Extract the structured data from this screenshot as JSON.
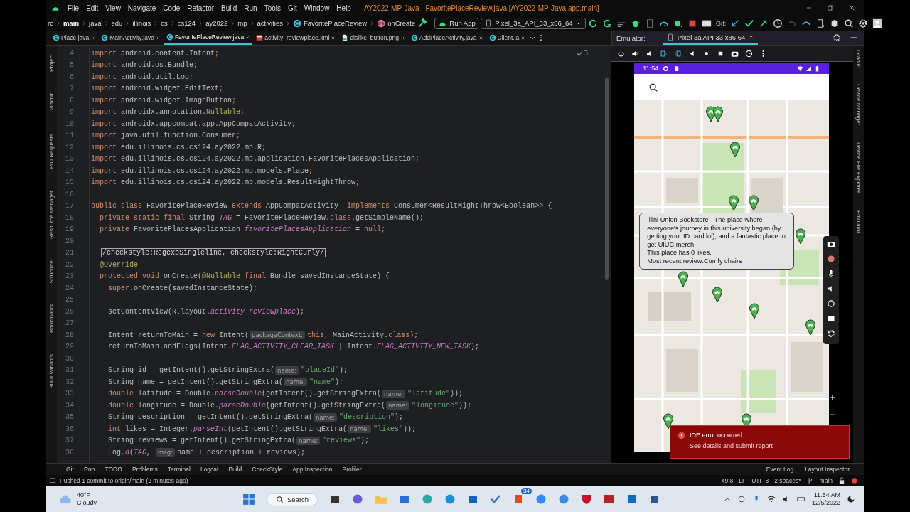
{
  "menu_bar": {
    "items": [
      "File",
      "Edit",
      "View",
      "Navigate",
      "Code",
      "Refactor",
      "Build",
      "Run",
      "Tools",
      "Git",
      "Window",
      "Help"
    ],
    "title": "AY2022-MP-Java - FavoritePlaceReview.java [AY2022-MP-Java.app.main]"
  },
  "breadcrumb": [
    {
      "label": "rc",
      "emphasis": false,
      "kind": "folder"
    },
    {
      "label": "main",
      "emphasis": true,
      "kind": "folder"
    },
    {
      "label": "java",
      "emphasis": false,
      "kind": "folder"
    },
    {
      "label": "edu",
      "emphasis": false,
      "kind": "folder"
    },
    {
      "label": "illinois",
      "emphasis": false,
      "kind": "folder"
    },
    {
      "label": "cs",
      "emphasis": false,
      "kind": "folder"
    },
    {
      "label": "cs124",
      "emphasis": false,
      "kind": "folder"
    },
    {
      "label": "ay2022",
      "emphasis": false,
      "kind": "folder"
    },
    {
      "label": "mp",
      "emphasis": false,
      "kind": "folder"
    },
    {
      "label": "activities",
      "emphasis": false,
      "kind": "folder"
    },
    {
      "label": "FavoritePlaceReview",
      "emphasis": false,
      "kind": "class"
    },
    {
      "label": "onCreate",
      "emphasis": false,
      "kind": "method"
    }
  ],
  "run_config": "Run App",
  "device": "Pixel_3a_API_33_x86_64",
  "git_label": "Git:",
  "tabs": [
    {
      "label": "Place.java",
      "kind": "java",
      "selected": false
    },
    {
      "label": "MainActivity.java",
      "kind": "java",
      "selected": false
    },
    {
      "label": "FavoritePlaceReview.java",
      "kind": "java",
      "selected": true
    },
    {
      "label": "activity_reviewplace.xml",
      "kind": "xml",
      "selected": false
    },
    {
      "label": "dislike_button.png",
      "kind": "png",
      "selected": false
    },
    {
      "label": "AddPlaceActivity.java",
      "kind": "java",
      "selected": false
    },
    {
      "label": "Client.ja",
      "kind": "java",
      "selected": false
    }
  ],
  "left_tools": [
    "Project",
    "Commit",
    "Pull Requests",
    "Resource Manager",
    "Structure",
    "Bookmarks",
    "Build Variants"
  ],
  "right_tools": [
    "Gradle",
    "Device Manager",
    "Device File Explorer",
    "Emulator"
  ],
  "editor": {
    "inspection_count": "3",
    "lines": [
      {
        "number": "4",
        "segments": [
          {
            "kind": "kw",
            "text": "import "
          },
          {
            "kind": "plain",
            "text": "android.content.Intent"
          },
          {
            "kind": "kw",
            "text": ";"
          }
        ]
      },
      {
        "number": "5",
        "segments": [
          {
            "kind": "kw",
            "text": "import "
          },
          {
            "kind": "plain",
            "text": "android.os.Bundle"
          },
          {
            "kind": "kw",
            "text": ";"
          }
        ]
      },
      {
        "number": "6",
        "segments": [
          {
            "kind": "kw",
            "text": "import "
          },
          {
            "kind": "plain",
            "text": "android.util.Log"
          },
          {
            "kind": "kw",
            "text": ";"
          }
        ]
      },
      {
        "number": "7",
        "segments": [
          {
            "kind": "kw",
            "text": "import "
          },
          {
            "kind": "plain",
            "text": "android.widget.EditText"
          },
          {
            "kind": "kw",
            "text": ";"
          }
        ]
      },
      {
        "number": "8",
        "segments": [
          {
            "kind": "kw",
            "text": "import "
          },
          {
            "kind": "plain",
            "text": "android.widget.ImageButton"
          },
          {
            "kind": "kw",
            "text": ";"
          }
        ]
      },
      {
        "number": "9",
        "segments": [
          {
            "kind": "kw",
            "text": "import "
          },
          {
            "kind": "plain",
            "text": "androidx.annotation."
          },
          {
            "kind": "ann",
            "text": "Nullable"
          },
          {
            "kind": "kw",
            "text": ";"
          }
        ]
      },
      {
        "number": "10",
        "segments": [
          {
            "kind": "kw",
            "text": "import "
          },
          {
            "kind": "plain",
            "text": "androidx.appcompat.app.AppCompatActivity"
          },
          {
            "kind": "kw",
            "text": ";"
          }
        ]
      },
      {
        "number": "11",
        "segments": [
          {
            "kind": "kw",
            "text": "import "
          },
          {
            "kind": "plain",
            "text": "java.util.function.Consumer"
          },
          {
            "kind": "kw",
            "text": ";"
          }
        ]
      },
      {
        "number": "12",
        "segments": [
          {
            "kind": "kw",
            "text": "import "
          },
          {
            "kind": "plain",
            "text": "edu.illinois.cs.cs124.ay2022.mp.R"
          },
          {
            "kind": "kw",
            "text": ";"
          }
        ]
      },
      {
        "number": "13",
        "segments": [
          {
            "kind": "kw",
            "text": "import "
          },
          {
            "kind": "plain",
            "text": "edu.illinois.cs.cs124.ay2022.mp.application.FavoritePlacesApplication"
          },
          {
            "kind": "kw",
            "text": ";"
          }
        ]
      },
      {
        "number": "14",
        "segments": [
          {
            "kind": "kw",
            "text": "import "
          },
          {
            "kind": "plain",
            "text": "edu.illinois.cs.cs124.ay2022.mp.models.Place"
          },
          {
            "kind": "kw",
            "text": ";"
          }
        ]
      },
      {
        "number": "15",
        "segments": [
          {
            "kind": "kw",
            "text": "import "
          },
          {
            "kind": "plain",
            "text": "edu.illinois.cs.cs124.ay2022.mp.models.ResultMightThrow"
          },
          {
            "kind": "kw",
            "text": ";"
          }
        ]
      },
      {
        "number": "16"
      },
      {
        "number": "17",
        "segments": [
          {
            "kind": "kw",
            "text": "public class "
          },
          {
            "kind": "plain",
            "text": "FavoritePlaceReview "
          },
          {
            "kind": "kw",
            "text": "extends "
          },
          {
            "kind": "plain",
            "text": "AppCompatActivity  "
          },
          {
            "kind": "kw",
            "text": "implements "
          },
          {
            "kind": "plain",
            "text": "Consumer<ResultMightThrow<Boolean>> {"
          }
        ]
      },
      {
        "number": "18",
        "segments": [
          {
            "kind": "kw",
            "text": "  private static final "
          },
          {
            "kind": "plain",
            "text": "String "
          },
          {
            "kind": "field",
            "text": "TAG"
          },
          {
            "kind": "plain",
            "text": " = FavoritePlaceReview."
          },
          {
            "kind": "kw",
            "text": "class"
          },
          {
            "kind": "plain",
            "text": ".getSimpleName();"
          }
        ]
      },
      {
        "number": "19",
        "segments": [
          {
            "kind": "kw",
            "text": "  private "
          },
          {
            "kind": "plain",
            "text": "FavoritePlacesApplication "
          },
          {
            "kind": "field",
            "text": "favoritePlacesApplication"
          },
          {
            "kind": "plain",
            "text": " = "
          },
          {
            "kind": "kw",
            "text": "null;"
          }
        ]
      },
      {
        "number": "20"
      },
      {
        "number": "21",
        "segments": [
          {
            "kind": "boxed",
            "text": "/checkstyle:RegexpSingleline, checkstyle:RightCurly/"
          }
        ]
      },
      {
        "number": "22",
        "segments": [
          {
            "kind": "ann",
            "text": "  @Override"
          }
        ]
      },
      {
        "number": "23",
        "segments": [
          {
            "kind": "kw",
            "text": "  protected void "
          },
          {
            "kind": "plain",
            "text": "onCreate("
          },
          {
            "kind": "ann",
            "text": "@Nullable "
          },
          {
            "kind": "kw",
            "text": "final "
          },
          {
            "kind": "plain",
            "text": "Bundle savedInstanceState) {"
          }
        ]
      },
      {
        "number": "24",
        "segments": [
          {
            "kind": "kw",
            "text": "    super"
          },
          {
            "kind": "plain",
            "text": ".onCreate(savedInstanceState);"
          }
        ]
      },
      {
        "number": "25"
      },
      {
        "number": "26",
        "segments": [
          {
            "kind": "plain",
            "text": "    setContentView(R.layout."
          },
          {
            "kind": "field",
            "text": "activity_reviewplace"
          },
          {
            "kind": "plain",
            "text": ");"
          }
        ]
      },
      {
        "number": "27"
      },
      {
        "number": "28",
        "segments": [
          {
            "kind": "plain",
            "text": "    Intent returnToMain = "
          },
          {
            "kind": "kw",
            "text": "new "
          },
          {
            "kind": "plain",
            "text": "Intent("
          },
          {
            "kind": "hint",
            "text": "packageContext:"
          },
          {
            "kind": "kw",
            "text": "this, "
          },
          {
            "kind": "plain",
            "text": "MainActivity."
          },
          {
            "kind": "kw",
            "text": "class"
          },
          {
            "kind": "plain",
            "text": ");"
          }
        ]
      },
      {
        "number": "29",
        "segments": [
          {
            "kind": "plain",
            "text": "    returnToMain.addFlags(Intent."
          },
          {
            "kind": "field",
            "text": "FLAG_ACTIVITY_CLEAR_TASK"
          },
          {
            "kind": "plain",
            "text": " | Intent."
          },
          {
            "kind": "field",
            "text": "FLAG_ACTIVITY_NEW_TASK"
          },
          {
            "kind": "plain",
            "text": ");"
          }
        ]
      },
      {
        "number": "30"
      },
      {
        "number": "31",
        "segments": [
          {
            "kind": "plain",
            "text": "    String id = getIntent().getStringExtra("
          },
          {
            "kind": "hint",
            "text": "name:"
          },
          {
            "kind": "str",
            "text": "\"placeId\""
          },
          {
            "kind": "plain",
            "text": ");"
          }
        ]
      },
      {
        "number": "32",
        "segments": [
          {
            "kind": "plain",
            "text": "    String name = getIntent().getStringExtra("
          },
          {
            "kind": "hint",
            "text": "name:"
          },
          {
            "kind": "str",
            "text": "\"name\""
          },
          {
            "kind": "plain",
            "text": ");"
          }
        ]
      },
      {
        "number": "33",
        "segments": [
          {
            "kind": "kw",
            "text": "    double "
          },
          {
            "kind": "plain",
            "text": "latitude = Double."
          },
          {
            "kind": "field",
            "text": "parseDouble"
          },
          {
            "kind": "plain",
            "text": "(getIntent().getStringExtra("
          },
          {
            "kind": "hint",
            "text": "name:"
          },
          {
            "kind": "str",
            "text": "\"latitude\""
          },
          {
            "kind": "plain",
            "text": "));"
          }
        ]
      },
      {
        "number": "34",
        "segments": [
          {
            "kind": "kw",
            "text": "    double "
          },
          {
            "kind": "plain",
            "text": "longitude = Double."
          },
          {
            "kind": "field",
            "text": "parseDouble"
          },
          {
            "kind": "plain",
            "text": "(getIntent().getStringExtra("
          },
          {
            "kind": "hint",
            "text": "name:"
          },
          {
            "kind": "str",
            "text": "\"longitude\""
          },
          {
            "kind": "plain",
            "text": "));"
          }
        ]
      },
      {
        "number": "35",
        "segments": [
          {
            "kind": "plain",
            "text": "    String description = getIntent().getStringExtra("
          },
          {
            "kind": "hint",
            "text": "name:"
          },
          {
            "kind": "str",
            "text": "\"description\""
          },
          {
            "kind": "plain",
            "text": ");"
          }
        ]
      },
      {
        "number": "36",
        "segments": [
          {
            "kind": "kw",
            "text": "    int "
          },
          {
            "kind": "plain",
            "text": "likes = Integer."
          },
          {
            "kind": "field",
            "text": "parseInt"
          },
          {
            "kind": "plain",
            "text": "(getIntent().getStringExtra("
          },
          {
            "kind": "hint",
            "text": "name:"
          },
          {
            "kind": "str",
            "text": "\"likes\""
          },
          {
            "kind": "plain",
            "text": "));"
          }
        ]
      },
      {
        "number": "37",
        "segments": [
          {
            "kind": "plain",
            "text": "    String reviews = getIntent().getStringExtra("
          },
          {
            "kind": "hint",
            "text": "name:"
          },
          {
            "kind": "str",
            "text": "\"reviews\""
          },
          {
            "kind": "plain",
            "text": ");"
          }
        ]
      },
      {
        "number": "38",
        "segments": [
          {
            "kind": "plain",
            "text": "    Log."
          },
          {
            "kind": "field",
            "text": "d"
          },
          {
            "kind": "plain",
            "text": "("
          },
          {
            "kind": "field",
            "text": "TAG"
          },
          {
            "kind": "plain",
            "text": ", "
          },
          {
            "kind": "hint",
            "text": "msg:"
          },
          {
            "kind": "plain",
            "text": "name + description + reviews);"
          }
        ]
      }
    ]
  },
  "emulator": {
    "label": "Emulator:",
    "tab": "Pixel 3a API 33 x86 64",
    "time": "11:54",
    "popup": {
      "description": "Illini Union Bookstore - The place where everyone's journey in this university began (by getting your ID card lol), and a fantastic place to get UIUC merch.",
      "likes": "This place has 0 likes.",
      "review": "Most recent review:Comfy chairs"
    }
  },
  "notification": {
    "title": "IDE error occurred",
    "link": "See details and submit report"
  },
  "tool_windows": {
    "left": [
      "Git",
      "Run",
      "TODO",
      "Problems",
      "Terminal",
      "Logcat",
      "Build",
      "CheckStyle",
      "App Inspection",
      "Profiler"
    ],
    "right": [
      "Event Log",
      "Layout Inspector"
    ]
  },
  "status_bar": {
    "message": "Pushed 1 commit to origin/main (2 minutes ago)",
    "items": [
      "49:8",
      "LF",
      "UTF-8",
      "2 spaces*"
    ],
    "branch": "main"
  },
  "taskbar": {
    "temperature": "40°F",
    "condition": "Cloudy",
    "search": "Search",
    "badge": "34",
    "time": "11:54 AM",
    "date": "12/5/2022"
  }
}
